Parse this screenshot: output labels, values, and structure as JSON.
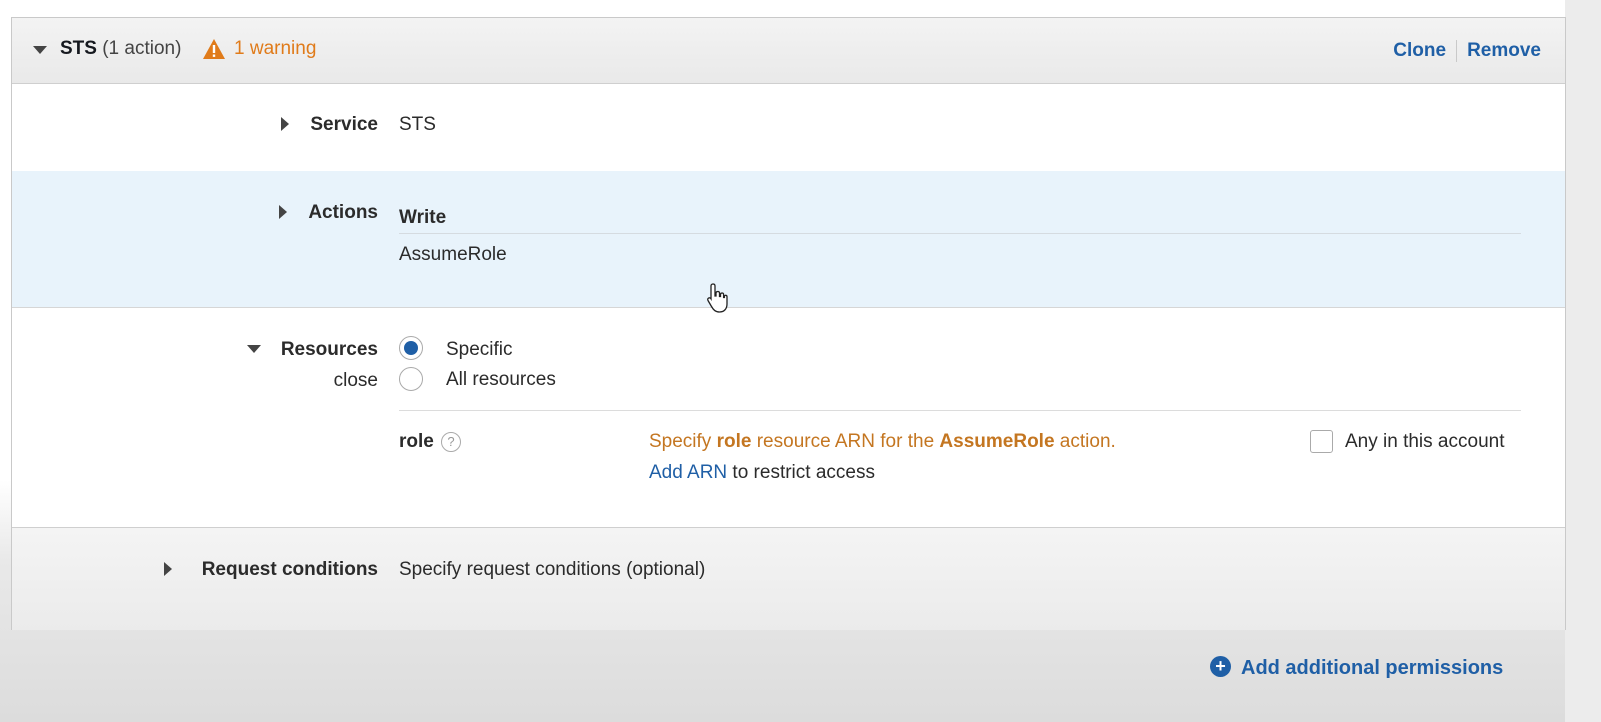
{
  "statement": {
    "title": "STS",
    "action_count": "(1 action)",
    "warning": "1 warning",
    "clone_label": "Clone",
    "remove_label": "Remove"
  },
  "service": {
    "label": "Service",
    "value": "STS"
  },
  "actions": {
    "label": "Actions",
    "group": "Write",
    "items": [
      "AssumeRole"
    ]
  },
  "resources": {
    "label": "Resources",
    "close_label": "close",
    "options": [
      {
        "label": "Specific",
        "checked": true
      },
      {
        "label": "All resources",
        "checked": false
      }
    ],
    "role": {
      "label": "role",
      "help": "?",
      "msg_prefix": "Specify ",
      "msg_resource": "role",
      "msg_middle": " resource ARN for the ",
      "msg_action": "AssumeRole",
      "msg_suffix": " action.",
      "add_arn_label": "Add ARN",
      "restrict_text": " to restrict access",
      "any_account_label": "Any in this account"
    }
  },
  "conditions": {
    "label": "Request conditions",
    "link": "Specify request conditions (optional)"
  },
  "footer": {
    "add_permissions_label": "Add additional permissions"
  },
  "colors": {
    "link": "#1f5fa6",
    "warning": "#e07b1a",
    "actions_band": "#e8f3fb"
  }
}
